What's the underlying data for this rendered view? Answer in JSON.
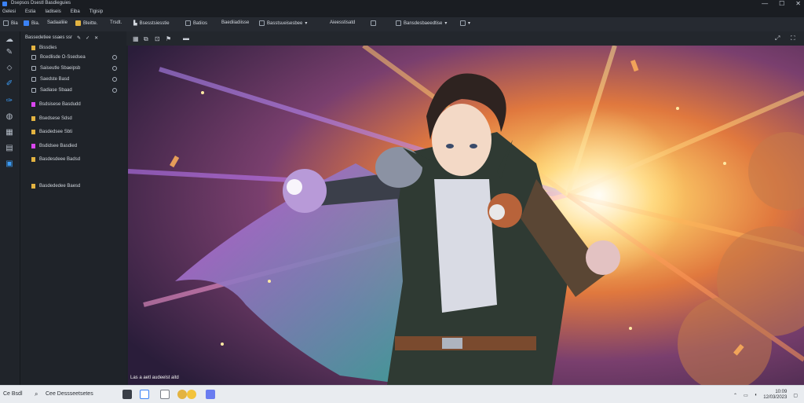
{
  "window": {
    "title": "Dsepsos Dsestl Basdieguies",
    "controls": [
      "—",
      "☐",
      "✕"
    ]
  },
  "menu": [
    "Gelesi",
    "Estia",
    "Iadiseis",
    "Eiba",
    "Tlgisip"
  ],
  "toolbar": {
    "items": [
      {
        "icon": "view-icon",
        "label": "Bia"
      },
      {
        "icon": "grid-icon",
        "label": "Bia."
      },
      {
        "icon": "layers-icon",
        "label": "Sadaaliiie"
      },
      {
        "icon": "folder-icon",
        "label": "Bleitte."
      },
      {
        "icon": "page-icon",
        "label": "Trsdt."
      },
      {
        "icon": "bookmark-icon",
        "label": "Bsesstsiesstie"
      },
      {
        "icon": "file-icon",
        "label": "Batiios"
      },
      {
        "icon": "filter-icon",
        "label": "Baediiadiisse"
      },
      {
        "icon": "sync-icon",
        "label": "Basstsueisesbee"
      },
      {
        "icon": "list-icon",
        "label": "Aieesstisatd"
      },
      {
        "icon": "image-icon",
        "label": ""
      },
      {
        "icon": "stack-icon",
        "label": "Bansdesbaeedtise"
      },
      {
        "icon": "chat-icon",
        "label": ""
      }
    ]
  },
  "panel": {
    "header": "Bassedetiee ssaes ssr",
    "header_icons": [
      "pencil-icon",
      "check-icon",
      "close-icon"
    ],
    "rows": [
      {
        "label": "Bissdies",
        "kind": "folder",
        "color": "#e3b341"
      },
      {
        "label": "Bcedlisde O-Ssedsea",
        "kind": "check",
        "color": ""
      },
      {
        "label": "Saiseutle Sbaeipsb",
        "kind": "check",
        "color": ""
      },
      {
        "label": "Saedste Basd",
        "kind": "check",
        "color": ""
      },
      {
        "label": "Sadiase Sbaad",
        "kind": "check",
        "color": ""
      },
      {
        "label": "Bsdsisese Basdudd",
        "kind": "tag",
        "color": "#d946ef"
      },
      {
        "label": "Bsedsese Sdsd",
        "kind": "tag",
        "color": "#e3b341"
      },
      {
        "label": "Basdedsee Sbti",
        "kind": "tag",
        "color": "#e3b341"
      },
      {
        "label": "Bsdidsee Basdied",
        "kind": "tag",
        "color": "#d946ef"
      },
      {
        "label": "Basdesdeee Badsd",
        "kind": "tag",
        "color": "#e3b341"
      },
      {
        "label": "Basdededee Baesd",
        "kind": "tag",
        "color": "#e3b341"
      }
    ]
  },
  "viewer": {
    "status": "Las a aetl audeelst aitd"
  },
  "taskbar": {
    "start_label": "Ce Bsdl",
    "search_label": "Cee Dessseetsetes",
    "tray_time": "10:09",
    "tray_date": "12/03/2023"
  },
  "colors": {
    "accent": "#3b82f6",
    "magenta": "#d946ef",
    "gold": "#e3b341"
  }
}
